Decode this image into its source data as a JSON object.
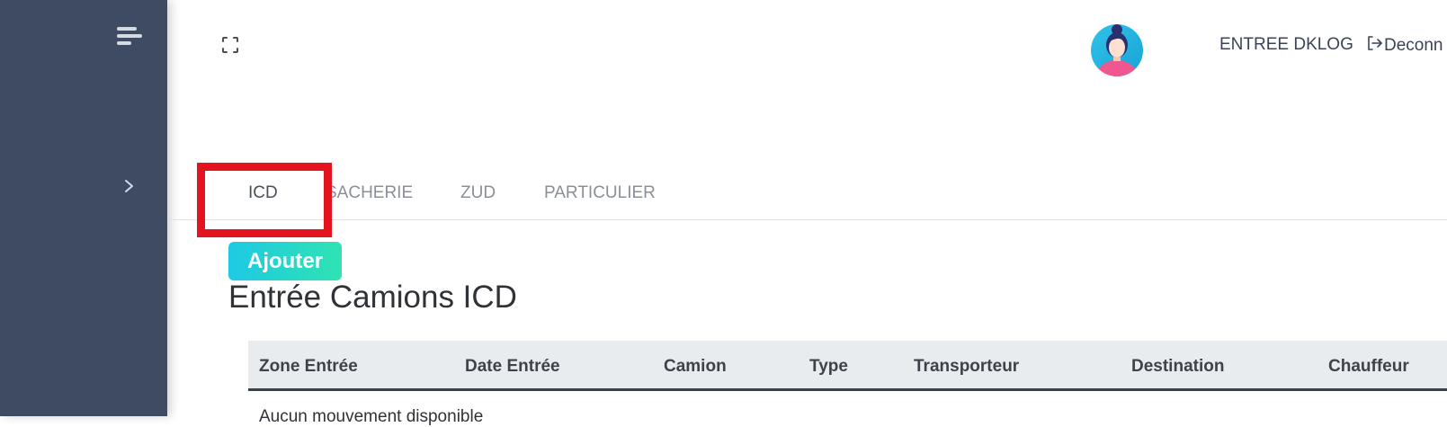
{
  "sidebar": {
    "menu_icon": "menu-icon",
    "expand_icon": "chevron-right-icon"
  },
  "header": {
    "fullscreen_icon": "fullscreen-icon",
    "avatar_icon": "user-avatar",
    "user_name": "ENTREE DKLOG",
    "logout_label": "Deconn",
    "logout_icon": "logout-icon"
  },
  "tabs": [
    {
      "label": "ICD",
      "active": true
    },
    {
      "label": "SACHERIE",
      "active": false
    },
    {
      "label": "ZUD",
      "active": false
    },
    {
      "label": "PARTICULIER",
      "active": false
    }
  ],
  "main": {
    "add_button_label": "Ajouter",
    "page_title": "Entrée Camions ICD"
  },
  "table": {
    "columns": [
      "Zone Entrée",
      "Date Entrée",
      "Camion",
      "Type",
      "Transporteur",
      "Destination",
      "Chauffeur"
    ],
    "empty_message": "Aucun mouvement disponible"
  },
  "colors": {
    "sidebar_bg": "#3f4b63",
    "highlight_box": "#e3141f",
    "add_button_gradient_start": "#1ec9e4",
    "add_button_gradient_end": "#2fe3b2"
  }
}
